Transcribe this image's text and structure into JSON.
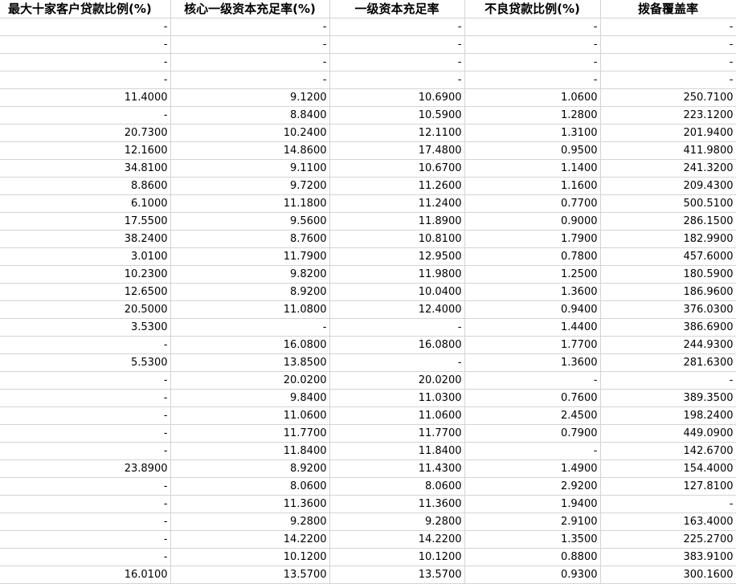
{
  "headers": [
    "最大十家客户贷款比例(%)",
    "核心一级资本充足率(%)",
    "一级资本充足率",
    "不良贷款比例(%)",
    "拨备覆盖率"
  ],
  "rows": [
    [
      "-",
      "-",
      "-",
      "-",
      "-"
    ],
    [
      "-",
      "-",
      "-",
      "-",
      "-"
    ],
    [
      "-",
      "-",
      "-",
      "-",
      "-"
    ],
    [
      "-",
      "-",
      "-",
      "-",
      "-"
    ],
    [
      "11.4000",
      "9.1200",
      "10.6900",
      "1.0600",
      "250.7100"
    ],
    [
      "-",
      "8.8400",
      "10.5900",
      "1.2800",
      "223.1200"
    ],
    [
      "20.7300",
      "10.2400",
      "12.1100",
      "1.3100",
      "201.9400"
    ],
    [
      "12.1600",
      "14.8600",
      "17.4800",
      "0.9500",
      "411.9800"
    ],
    [
      "34.8100",
      "9.1100",
      "10.6700",
      "1.1400",
      "241.3200"
    ],
    [
      "8.8600",
      "9.7200",
      "11.2600",
      "1.1600",
      "209.4300"
    ],
    [
      "6.1000",
      "11.1800",
      "11.2400",
      "0.7700",
      "500.5100"
    ],
    [
      "17.5500",
      "9.5600",
      "11.8900",
      "0.9000",
      "286.1500"
    ],
    [
      "38.2400",
      "8.7600",
      "10.8100",
      "1.7900",
      "182.9900"
    ],
    [
      "3.0100",
      "11.7900",
      "12.9500",
      "0.7800",
      "457.6000"
    ],
    [
      "10.2300",
      "9.8200",
      "11.9800",
      "1.2500",
      "180.5900"
    ],
    [
      "12.6500",
      "8.9200",
      "10.0400",
      "1.3600",
      "186.9600"
    ],
    [
      "20.5000",
      "11.0800",
      "12.4000",
      "0.9400",
      "376.0300"
    ],
    [
      "3.5300",
      "-",
      "-",
      "1.4400",
      "386.6900"
    ],
    [
      "-",
      "16.0800",
      "16.0800",
      "1.7700",
      "244.9300"
    ],
    [
      "5.5300",
      "13.8500",
      "-",
      "1.3600",
      "281.6300"
    ],
    [
      "-",
      "20.0200",
      "20.0200",
      "-",
      "-"
    ],
    [
      "-",
      "9.8400",
      "11.0300",
      "0.7600",
      "389.3500"
    ],
    [
      "-",
      "11.0600",
      "11.0600",
      "2.4500",
      "198.2400"
    ],
    [
      "-",
      "11.7700",
      "11.7700",
      "0.7900",
      "449.0900"
    ],
    [
      "-",
      "11.8400",
      "11.8400",
      "-",
      "142.6700"
    ],
    [
      "23.8900",
      "8.9200",
      "11.4300",
      "1.4900",
      "154.4000"
    ],
    [
      "-",
      "8.0600",
      "8.0600",
      "2.9200",
      "127.8100"
    ],
    [
      "-",
      "11.3600",
      "11.3600",
      "1.9400",
      "-"
    ],
    [
      "-",
      "9.2800",
      "9.2800",
      "2.9100",
      "163.4000"
    ],
    [
      "-",
      "14.2200",
      "14.2200",
      "1.3500",
      "225.2700"
    ],
    [
      "-",
      "10.1200",
      "10.1200",
      "0.8800",
      "383.9100"
    ],
    [
      "16.0100",
      "13.5700",
      "13.5700",
      "0.9300",
      "300.1600"
    ]
  ]
}
